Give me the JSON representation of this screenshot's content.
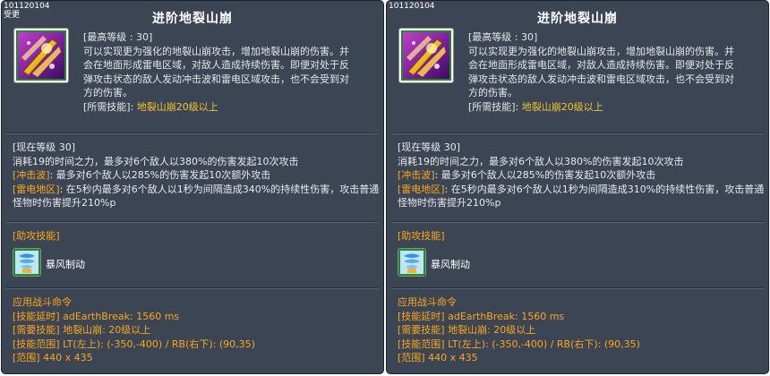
{
  "panels": [
    {
      "id": "101120104",
      "tag": "受更",
      "title": "进阶地裂山崩",
      "icon": "earth-break-skill-icon",
      "max_level": "[最高等级 : 30]",
      "desc_lines": [
        "可以实现更为强化的地裂山崩攻击，增加地裂山崩的伤害。并",
        "会在地面形成雷电区域，对敌人造成持续伤害。即便对处于反",
        "弹攻击状态的敌人发动冲击波和雷电区域攻击，也不会受到对",
        "方的伤害。"
      ],
      "required_label": "[所需技能]:",
      "required_value": "地裂山崩20级以上",
      "current_level": "[现在等级 30]",
      "effect_line": "消耗19的时间之力，最多对6个敌人以380%的伤害发起10次攻击",
      "shockwave_label": "[冲击波]",
      "shockwave_text": ": 最多对6个敌人以285%的伤害发起10次额外攻击",
      "thunder_label": "[雷电地区]",
      "thunder_text": ": 在5秒内最多对6个敌人以1秒为间隔造成340%的持续性伤害，攻击普通怪物时伤害提升210%p",
      "assist_label": "[助攻技能]",
      "assist_icon": "storm-control-skill-icon",
      "assist_name": "暴风制动",
      "command_title": "应用战斗命令",
      "cmd_delay_label": "[技能延时]",
      "cmd_delay_value": " adEarthBreak: 1560 ms",
      "cmd_req_label": "[需要技能]",
      "cmd_req_value": " 地裂山崩: 20级以上",
      "cmd_range_label": "[技能范围]",
      "cmd_range_value": " LT(左上): (-350,-400) / RB(右下): (90,35)",
      "cmd_area_label": "[范围]",
      "cmd_area_value": " 440 x 435"
    },
    {
      "id": "101120104",
      "tag": "",
      "title": "进阶地裂山崩",
      "icon": "earth-break-skill-icon",
      "max_level": "[最高等级 : 30]",
      "desc_lines": [
        "可以实现更为强化的地裂山崩攻击，增加地裂山崩的伤害。并",
        "会在地面形成雷电区域，对敌人造成持续伤害。即便对处于反",
        "弹攻击状态的敌人发动冲击波和雷电区域攻击，也不会受到对",
        "方的伤害。"
      ],
      "required_label": "[所需技能]:",
      "required_value": "地裂山崩20级以上",
      "current_level": "[现在等级 30]",
      "effect_line": "消耗19的时间之力，最多对6个敌人以380%的伤害发起10次攻击",
      "shockwave_label": "[冲击波]",
      "shockwave_text": ": 最多对6个敌人以285%的伤害发起10次额外攻击",
      "thunder_label": "[雷电地区]",
      "thunder_text": ": 在5秒内最多对6个敌人以1秒为间隔造成310%的持续性伤害，攻击普通怪物时伤害提升210%p",
      "assist_label": "[助攻技能]",
      "assist_icon": "storm-control-skill-icon",
      "assist_name": "暴风制动",
      "command_title": "应用战斗命令",
      "cmd_delay_label": "[技能延时]",
      "cmd_delay_value": " adEarthBreak: 1560 ms",
      "cmd_req_label": "[需要技能]",
      "cmd_req_value": " 地裂山崩: 20级以上",
      "cmd_range_label": "[技能范围]",
      "cmd_range_value": " LT(左上): (-350,-400) / RB(右下): (90,35)",
      "cmd_area_label": "[范围]",
      "cmd_area_value": " 440 x 435"
    }
  ]
}
